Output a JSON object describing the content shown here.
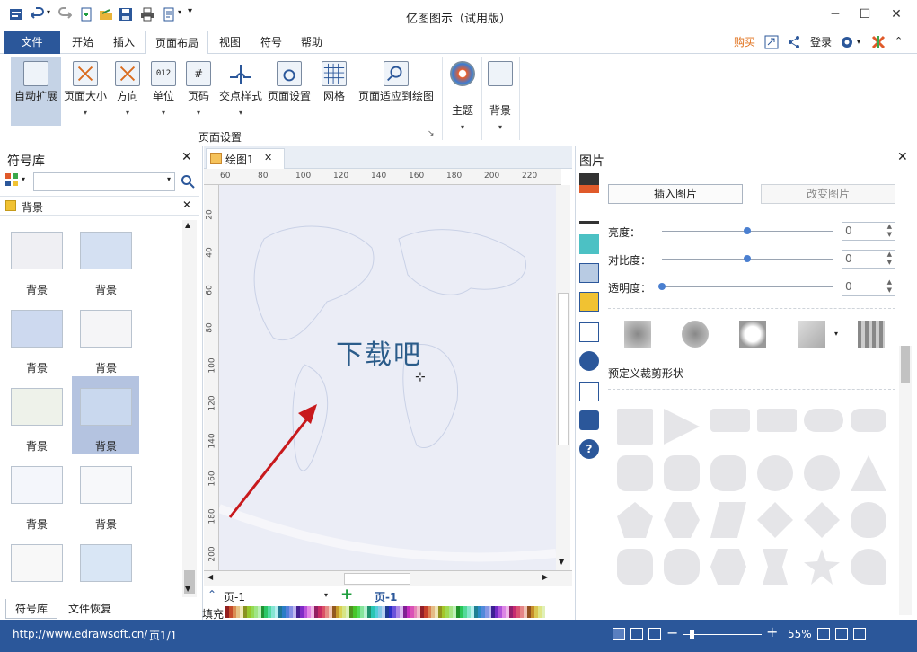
{
  "window": {
    "title": "亿图图示（试用版）",
    "minimize_glyph": "─",
    "maximize_glyph": "☐",
    "close_glyph": "✕"
  },
  "menu": {
    "file": "文件",
    "items": [
      "开始",
      "插入",
      "页面布局",
      "视图",
      "符号",
      "帮助"
    ],
    "active_index": 2,
    "right": {
      "buy": "购买",
      "login": "登录"
    }
  },
  "ribbon": {
    "buttons": [
      {
        "label": "自动扩展",
        "icon": "auto-extend-icon"
      },
      {
        "label": "页面大小",
        "icon": "page-size-icon"
      },
      {
        "label": "方向",
        "icon": "orientation-icon"
      },
      {
        "label": "单位",
        "icon": "unit-icon",
        "icon_text": "012"
      },
      {
        "label": "页码",
        "icon": "page-number-icon",
        "icon_text": "#"
      },
      {
        "label": "交点样式",
        "icon": "crossover-icon"
      },
      {
        "label": "页面设置",
        "icon": "page-setup-icon"
      },
      {
        "label": "网格",
        "icon": "grid-icon"
      },
      {
        "label": "页面适应到绘图",
        "icon": "fit-page-icon"
      }
    ],
    "group_label": "页面设置",
    "theme": "主题",
    "background": "背景"
  },
  "left_panel": {
    "title": "符号库",
    "search_placeholder": "",
    "category": "背景",
    "thumb_label": "背景",
    "thumb_colors": [
      "#efeff3",
      "#d4e0f2",
      "#cdd9ef",
      "#f5f5f7",
      "#eef2ea",
      "#c9d8ee",
      "#f4f6fb",
      "#f7f8fa",
      "#f8f8f8",
      "#d9e6f5"
    ],
    "tabs": [
      "符号库",
      "文件恢复"
    ]
  },
  "canvas": {
    "tab": "绘图1",
    "hruler": [
      "60",
      "80",
      "100",
      "120",
      "140",
      "160",
      "180",
      "200",
      "220"
    ],
    "vruler": [
      "20",
      "40",
      "60",
      "80",
      "100",
      "120",
      "140",
      "160",
      "180",
      "200"
    ],
    "text": "下载吧",
    "page_select": "页-1",
    "page_tab": "页-1",
    "fill_label": "填充"
  },
  "right_panel": {
    "title": "图片",
    "insert_btn": "插入图片",
    "change_btn": "改变图片",
    "sliders": [
      {
        "label": "亮度：",
        "value": "0",
        "level": 0.5
      },
      {
        "label": "对比度：",
        "value": "0",
        "level": 0.5
      },
      {
        "label": "透明度：",
        "value": "0",
        "level": 0.0
      }
    ],
    "crop_label": "预定义裁剪形状"
  },
  "status": {
    "url": "http://www.edrawsoft.cn/",
    "page": "页1/1",
    "zoom": "55%"
  },
  "colors": {
    "accent": "#2b579a",
    "buy": "#e0701b",
    "arrow": "#c8191c"
  }
}
